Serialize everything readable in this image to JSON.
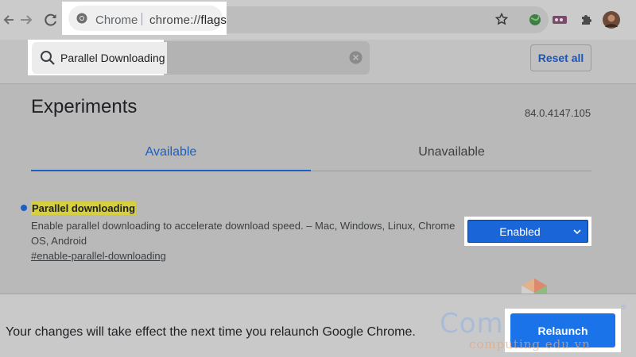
{
  "browser": {
    "omnibox": {
      "site_label": "Chrome",
      "url_scheme": "chrome://",
      "url_host": "flags"
    }
  },
  "search": {
    "query": "Parallel Downloading",
    "reset_label": "Reset all"
  },
  "main": {
    "title": "Experiments",
    "version": "84.0.4147.105",
    "tabs": [
      {
        "label": "Available",
        "active": true
      },
      {
        "label": "Unavailable",
        "active": false
      }
    ],
    "flag": {
      "title": "Parallel downloading",
      "description": "Enable parallel downloading to accelerate download speed. – Mac, Windows, Linux, Chrome OS, Android",
      "link": "#enable-parallel-downloading",
      "selected_option": "Enabled"
    }
  },
  "footer": {
    "message": "Your changes will take effect the next time you relaunch Google Chrome.",
    "relaunch_label": "Relaunch"
  },
  "watermark": {
    "text": "Computing",
    "subtext": "computing.edu.vn"
  },
  "colors": {
    "accent": "#1a73e8",
    "highlight": "#d6cf3e"
  }
}
